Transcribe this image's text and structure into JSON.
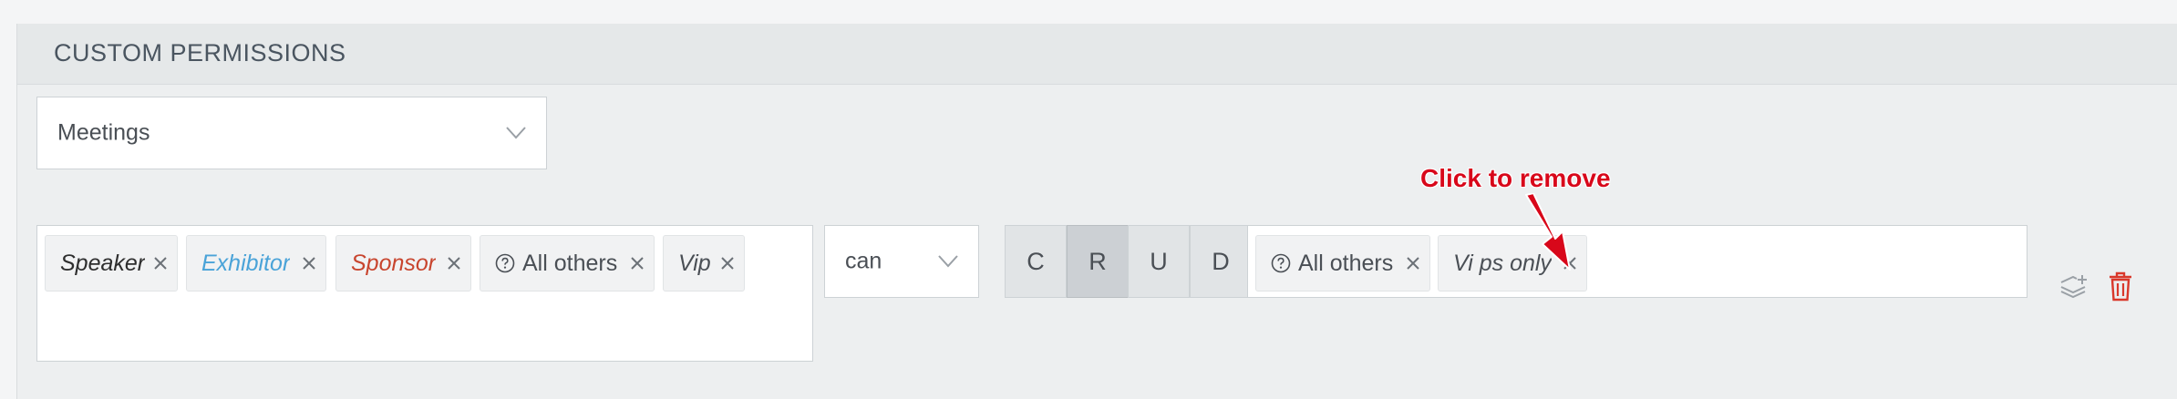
{
  "panel": {
    "title": "CUSTOM PERMISSIONS"
  },
  "module_select": {
    "value": "Meetings",
    "icon": "chevron-down-icon"
  },
  "roles": [
    {
      "label": "Speaker",
      "italic": true,
      "color": "#2e2e2e"
    },
    {
      "label": "Exhibitor",
      "italic": true,
      "color": "#4aa3d8"
    },
    {
      "label": "Sponsor",
      "italic": true,
      "color": "#c8452e"
    },
    {
      "label": "All others",
      "italic": false,
      "color": "#4a4f55",
      "icon": "question-circle-icon"
    },
    {
      "label": "Vip",
      "italic": true,
      "color": "#4a4f55"
    }
  ],
  "verb_select": {
    "value": "can",
    "icon": "chevron-down-icon"
  },
  "crud": [
    {
      "letter": "C",
      "active": false
    },
    {
      "letter": "R",
      "active": true
    },
    {
      "letter": "U",
      "active": false
    },
    {
      "letter": "D",
      "active": false
    }
  ],
  "scope": [
    {
      "label": "All others",
      "italic": false,
      "icon": "question-circle-icon"
    },
    {
      "label": "Vi ps only",
      "italic": true
    }
  ],
  "annotation": {
    "text": "Click to remove",
    "color": "#d8071a"
  },
  "actions": {
    "duplicate_icon": "layers-plus-icon",
    "delete_icon": "trash-icon",
    "delete_color": "#d9382b"
  }
}
